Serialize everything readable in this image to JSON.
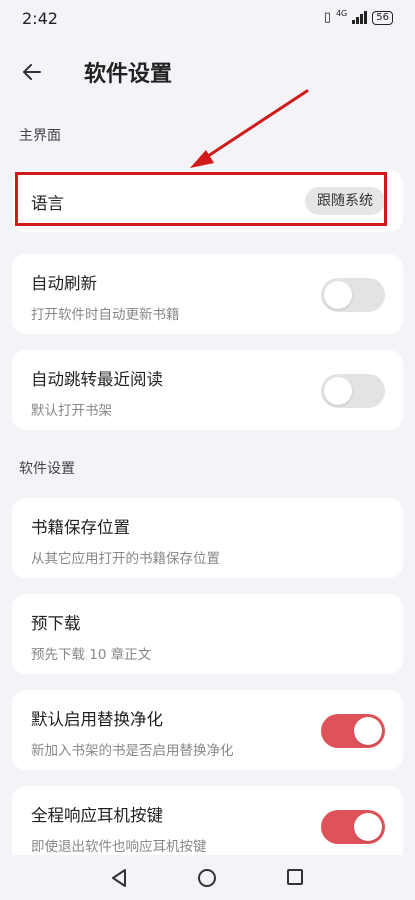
{
  "status_bar": {
    "time": "2:42",
    "network": "4G",
    "battery": "56"
  },
  "app_bar": {
    "title": "软件设置"
  },
  "sections": {
    "main_ui": "主界面",
    "software": "软件设置"
  },
  "settings": {
    "language": {
      "label": "语言",
      "value": "跟随系统"
    },
    "auto_refresh": {
      "label": "自动刷新",
      "description": "打开软件时自动更新书籍",
      "enabled": false
    },
    "auto_jump": {
      "label": "自动跳转最近阅读",
      "description": "默认打开书架",
      "enabled": false
    },
    "save_location": {
      "label": "书籍保存位置",
      "description": "从其它应用打开的书籍保存位置"
    },
    "pre_download": {
      "label": "预下载",
      "description": "预先下载 10 章正文"
    },
    "replace_clean": {
      "label": "默认启用替换净化",
      "description": "新加入书架的书是否启用替换净化",
      "enabled": true
    },
    "headset_keys": {
      "label": "全程响应耳机按键",
      "description": "即使退出软件也响应耳机按键",
      "enabled": true
    }
  },
  "colors": {
    "accent": "#e0525a",
    "annotation": "#d11a1a",
    "background": "#f4f3f8"
  }
}
